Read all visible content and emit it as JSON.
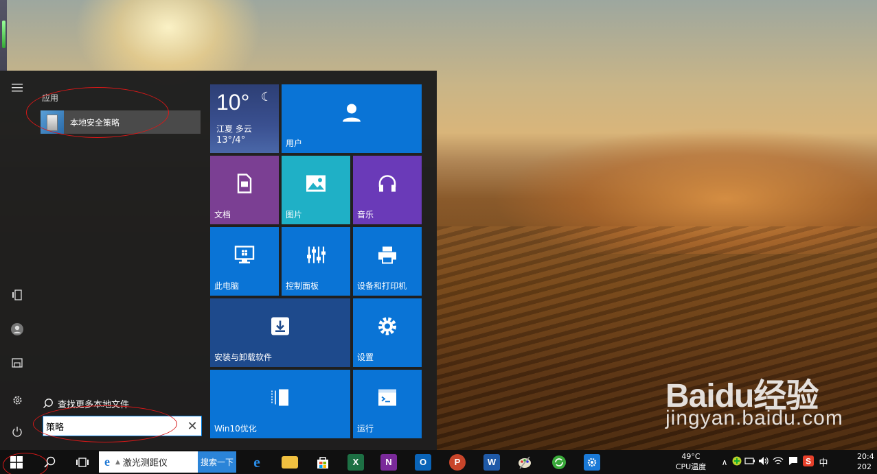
{
  "start_menu": {
    "section_label": "应用",
    "best_match": {
      "label": "本地安全策略",
      "icon": "security-policy-icon"
    },
    "more_files_label": "查找更多本地文件",
    "search_value": "策略",
    "rail_icons": [
      "menu-icon",
      "tablet-mode-icon",
      "account-icon",
      "file-explorer-icon",
      "settings-icon",
      "power-icon"
    ]
  },
  "tiles": {
    "weather": {
      "temp": "10°",
      "location": "江夏 多云",
      "range": "13°/4°"
    },
    "users": "用户",
    "documents": "文档",
    "pictures": "图片",
    "music": "音乐",
    "this_pc": "此电脑",
    "control_panel": "控制面板",
    "devices_printers": "设备和打印机",
    "install_uninstall": "安装与卸载软件",
    "settings": "设置",
    "win10_opt": "Win10优化",
    "run": "运行"
  },
  "taskbar": {
    "address_text": "激光测距仪",
    "search_button": "搜索一下",
    "cpu_temp": "49°C",
    "cpu_label": "CPU温度",
    "ime": "中",
    "clock_time": "20:4",
    "clock_date": "202",
    "pinned": [
      "edge-icon",
      "file-explorer-icon",
      "store-icon",
      "excel-icon",
      "onenote-icon",
      "outlook-icon",
      "powerpoint-icon",
      "word-icon",
      "paint-icon",
      "refresh-app-icon",
      "settings-app-icon"
    ]
  },
  "watermark": {
    "logo": "Baidu经验",
    "url": "jingyan.baidu.com"
  },
  "colors": {
    "tile_blue": "#0a74d6",
    "tile_purple": "#7b3f93",
    "tile_teal": "#1fb0c6",
    "tile_violet": "#6a3ab8",
    "tile_navy": "#1e4a8c",
    "annotation_red": "#d81818"
  }
}
